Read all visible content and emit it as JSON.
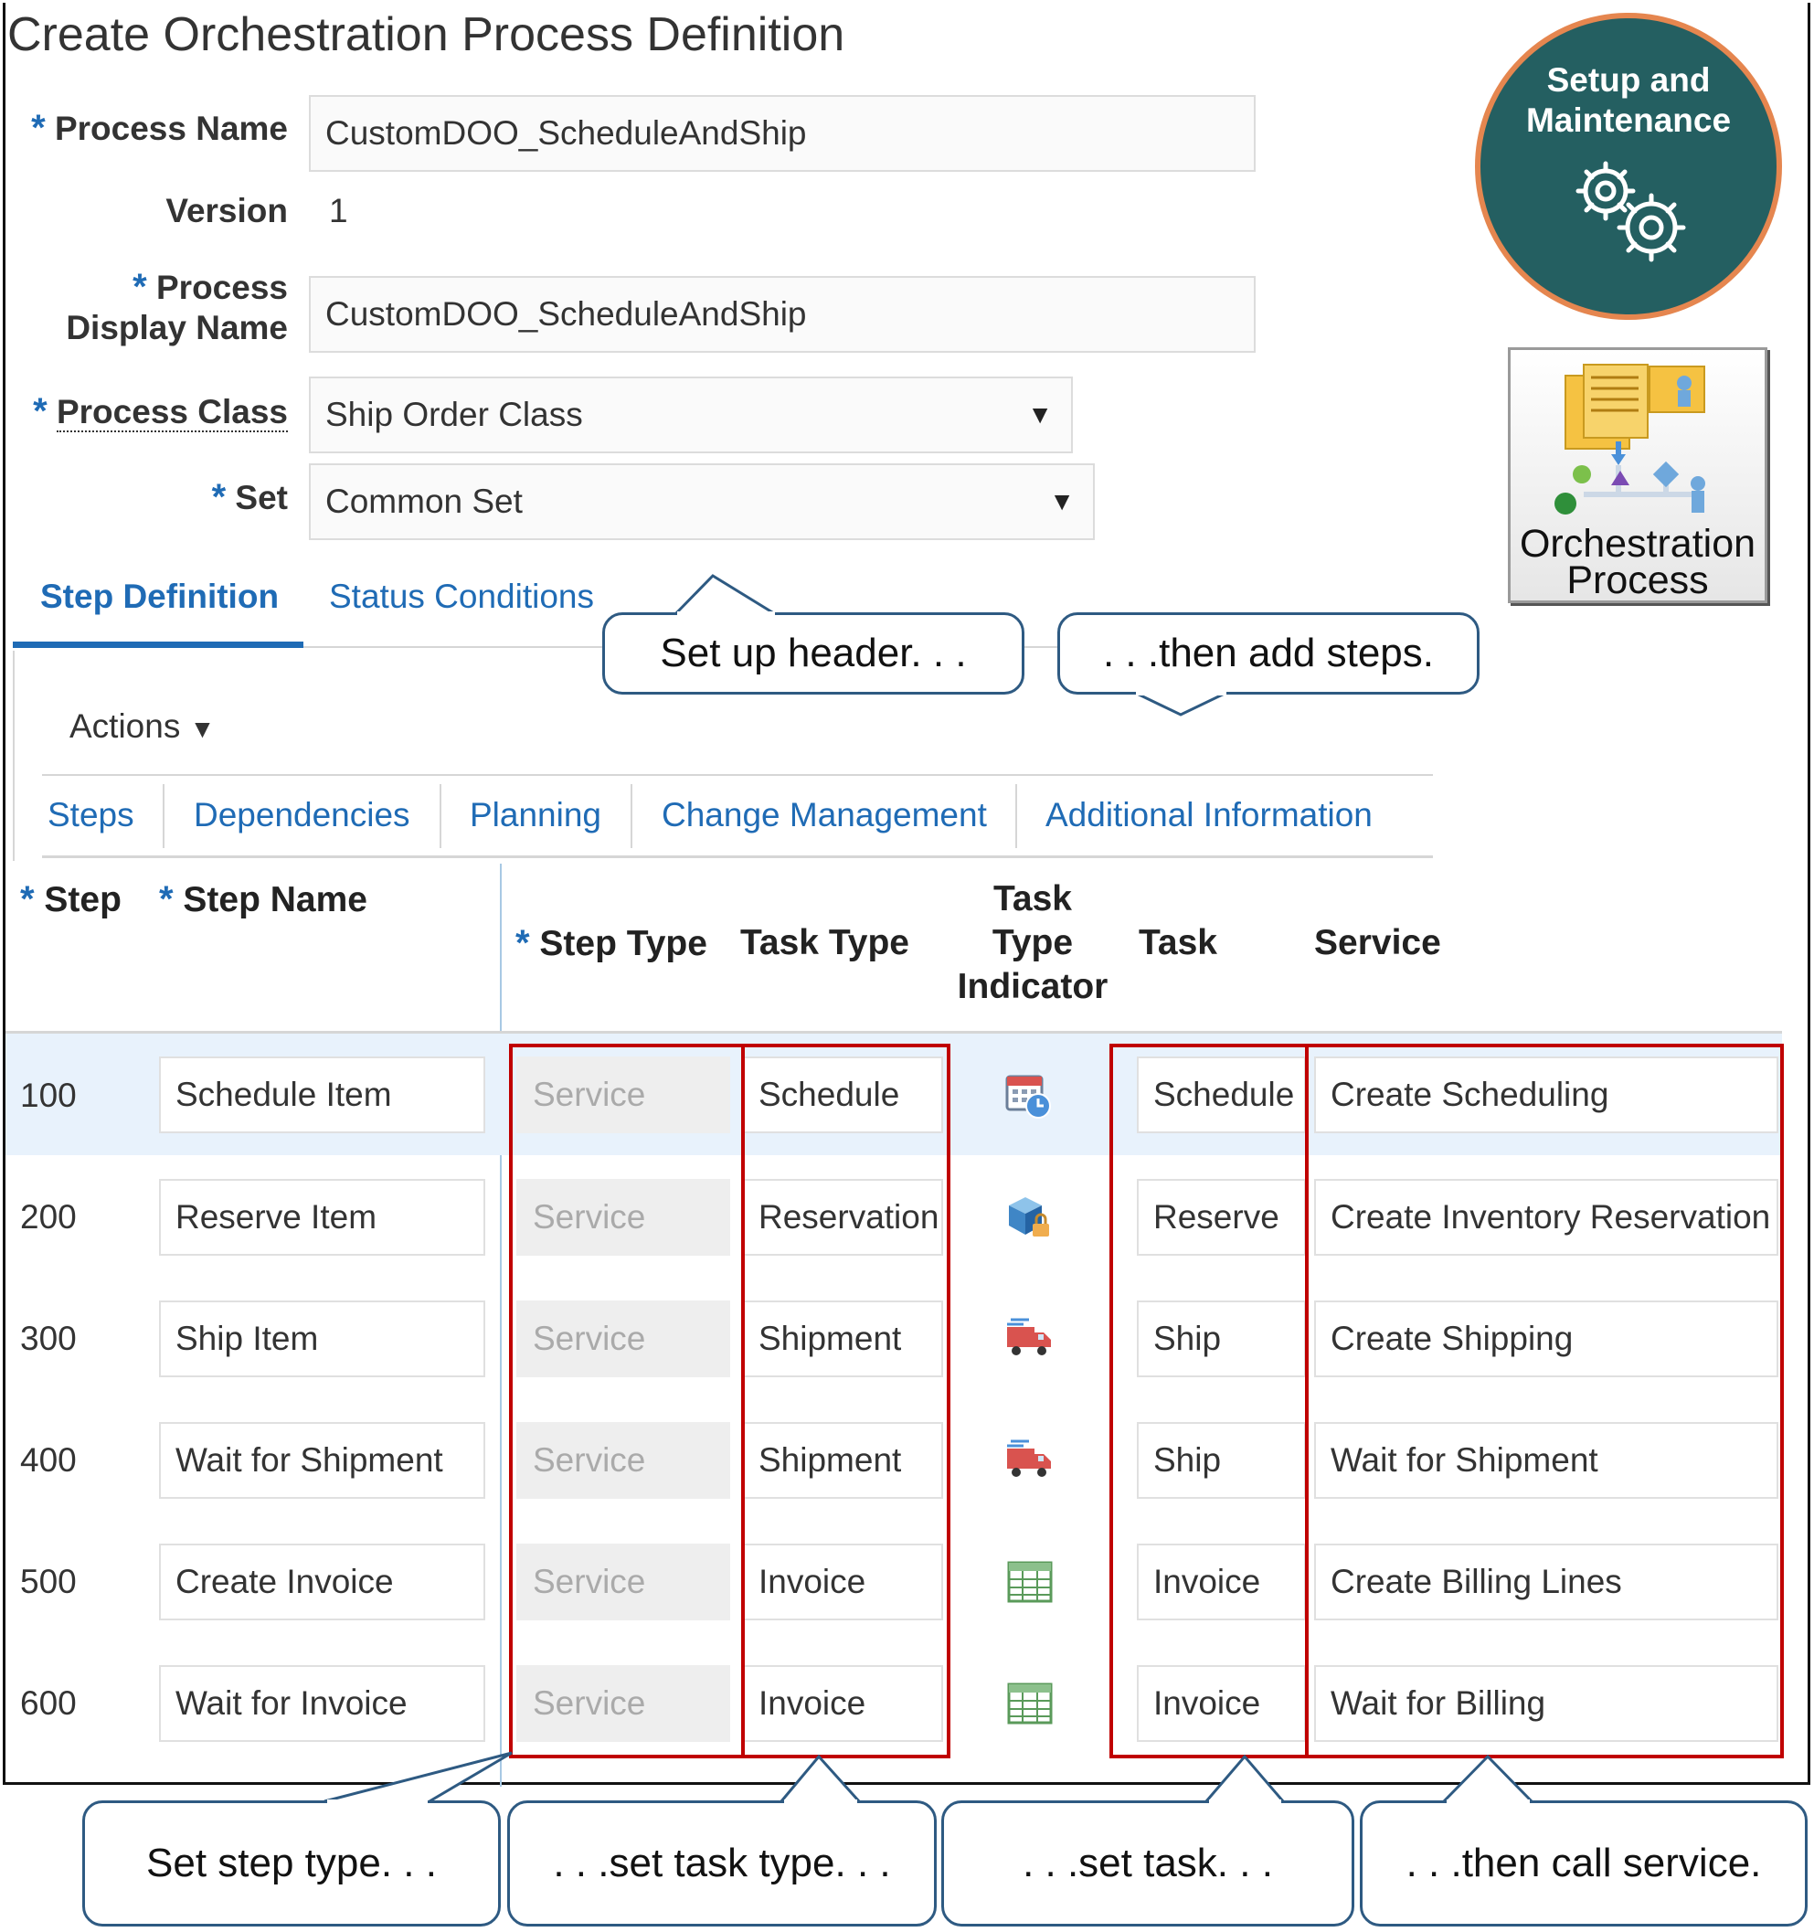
{
  "page": {
    "title": "Create Orchestration Process Definition"
  },
  "header": {
    "required_marker": "*",
    "process_name": {
      "label": "Process Name",
      "value": "CustomDOO_ScheduleAndShip"
    },
    "version": {
      "label": "Version",
      "value": "1"
    },
    "display_name": {
      "label_line1": "Process",
      "label_line2": "Display Name",
      "value": "CustomDOO_ScheduleAndShip"
    },
    "process_class": {
      "label": "Process Class",
      "value": "Ship Order Class"
    },
    "set": {
      "label": "Set",
      "value": "Common Set"
    },
    "dropdown_glyph": "▼"
  },
  "tabs": [
    {
      "label": "Step Definition",
      "active": true
    },
    {
      "label": "Status Conditions",
      "active": false
    }
  ],
  "actions": {
    "label": "Actions"
  },
  "subtabs": [
    "Steps",
    "Dependencies",
    "Planning",
    "Change Management",
    "Additional Information"
  ],
  "table": {
    "headers": {
      "step": "Step",
      "step_name": "Step Name",
      "step_type": "Step Type",
      "task_type": "Task Type",
      "indicator_line1": "Task",
      "indicator_line2": "Type",
      "indicator_line3": "Indicator",
      "task": "Task",
      "service": "Service"
    },
    "rows": [
      {
        "step": "100",
        "name": "Schedule Item",
        "step_type": "Service",
        "task_type": "Schedule",
        "indicator_icon": "schedule-calendar-icon",
        "task": "Schedule",
        "service": "Create Scheduling",
        "highlighted": true
      },
      {
        "step": "200",
        "name": "Reserve Item",
        "step_type": "Service",
        "task_type": "Reservation",
        "indicator_icon": "reservation-box-lock-icon",
        "task": "Reserve",
        "service": "Create Inventory Reservation",
        "highlighted": false
      },
      {
        "step": "300",
        "name": "Ship Item",
        "step_type": "Service",
        "task_type": "Shipment",
        "indicator_icon": "shipment-truck-icon",
        "task": "Ship",
        "service": "Create Shipping",
        "highlighted": false
      },
      {
        "step": "400",
        "name": "Wait for Shipment",
        "step_type": "Service",
        "task_type": "Shipment",
        "indicator_icon": "shipment-truck-icon",
        "task": "Ship",
        "service": "Wait for Shipment",
        "highlighted": false
      },
      {
        "step": "500",
        "name": "Create Invoice",
        "step_type": "Service",
        "task_type": "Invoice",
        "indicator_icon": "invoice-grid-icon",
        "task": "Invoice",
        "service": "Create Billing Lines",
        "highlighted": false
      },
      {
        "step": "600",
        "name": "Wait for Invoice",
        "step_type": "Service",
        "task_type": "Invoice",
        "indicator_icon": "invoice-grid-icon",
        "task": "Invoice",
        "service": "Wait for Billing",
        "highlighted": false
      }
    ]
  },
  "callouts": {
    "header": "Set up header. . .",
    "steps": ". . .then add steps.",
    "step_type": "Set step type. . .",
    "task_type": ". . .set task type. . .",
    "task": ". . .set task. . .",
    "service": ". . .then call service."
  },
  "badges": {
    "setup": {
      "line1": "Setup and",
      "line2": "Maintenance",
      "icon": "gears-icon"
    },
    "orchestration": {
      "line1": "Orchestration",
      "line2": "Process",
      "icon": "orchestration-flow-icon"
    }
  },
  "colors": {
    "accent": "#1f6bb5",
    "highlight_box": "#c00000",
    "badge_fill": "#245f61",
    "badge_ring": "#e5864f",
    "callout_border": "#2e5a82"
  }
}
